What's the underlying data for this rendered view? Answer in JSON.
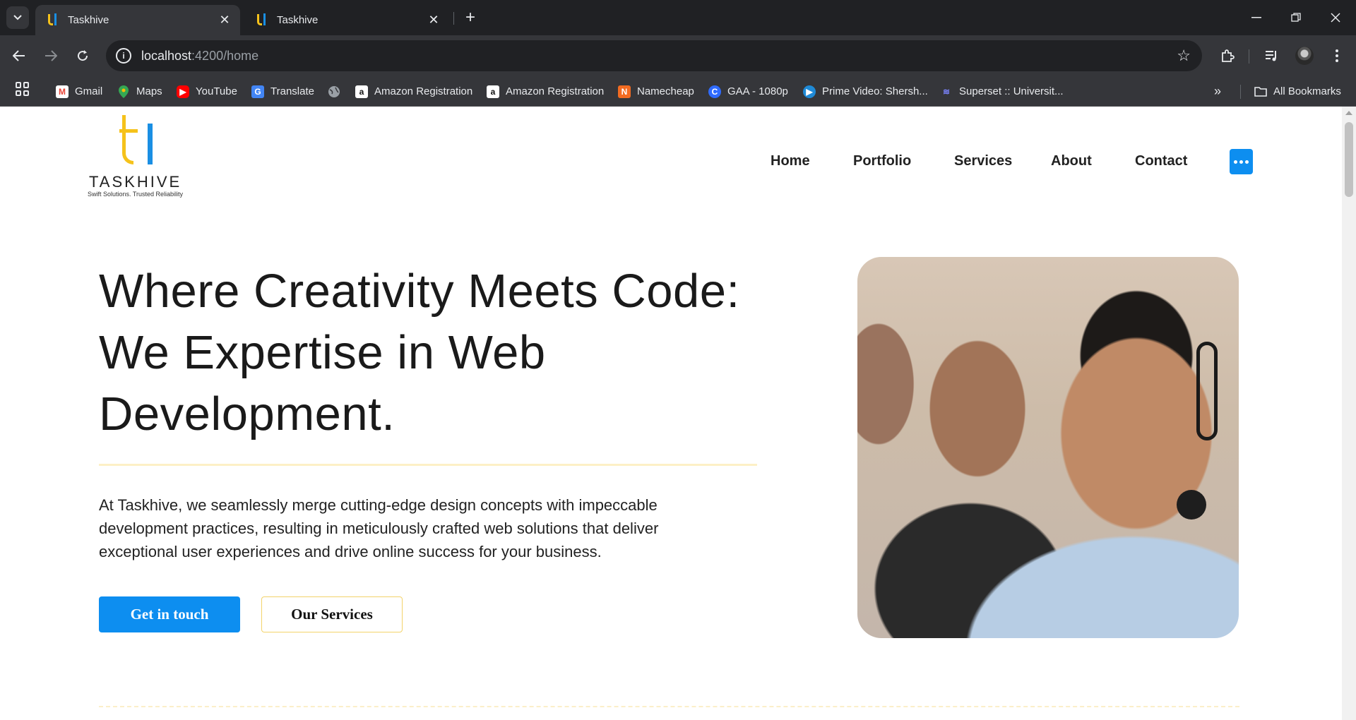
{
  "browser": {
    "tabs": [
      {
        "title": "Taskhive",
        "active": true
      },
      {
        "title": "Taskhive",
        "active": false
      }
    ],
    "url_host": "localhost",
    "url_path": ":4200/home",
    "bookmarks": [
      {
        "label": "Gmail",
        "icon": "gmail-icon"
      },
      {
        "label": "Maps",
        "icon": "maps-icon"
      },
      {
        "label": "YouTube",
        "icon": "youtube-icon"
      },
      {
        "label": "Translate",
        "icon": "translate-icon"
      },
      {
        "label": "",
        "icon": "globe-icon"
      },
      {
        "label": "Amazon Registration",
        "icon": "amazon-icon"
      },
      {
        "label": "Amazon Registration",
        "icon": "amazon-icon"
      },
      {
        "label": "Namecheap",
        "icon": "namecheap-icon"
      },
      {
        "label": "GAA - 1080p",
        "icon": "gaa-icon"
      },
      {
        "label": "Prime Video: Shersh...",
        "icon": "prime-video-icon"
      },
      {
        "label": "Superset :: Universit...",
        "icon": "superset-icon"
      }
    ],
    "all_bookmarks": "All Bookmarks"
  },
  "site": {
    "logo_word": "TASKHIVE",
    "logo_tagline": "Swift Solutions. Trusted Reliability",
    "nav": [
      "Home",
      "Portfolio",
      "Services",
      "About",
      "Contact"
    ],
    "hero_title": "Where Creativity Meets Code: We Expertise in Web Development.",
    "hero_description": "At Taskhive, we seamlessly merge cutting-edge design concepts with impeccable development practices, resulting in meticulously crafted web solutions that deliver exceptional user experiences and drive online success for your business.",
    "primary_button": "Get in touch",
    "secondary_button": "Our Services"
  },
  "colors": {
    "accent_blue": "#0d8ef0",
    "accent_yellow": "#f5c21b"
  }
}
